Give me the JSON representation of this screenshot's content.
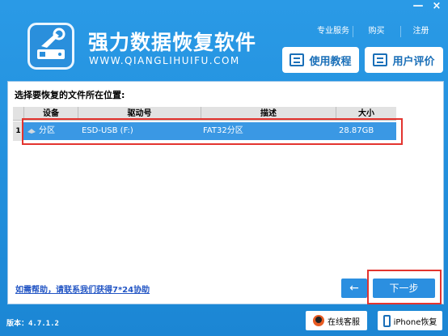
{
  "window": {
    "minimize_label": "—",
    "close_label": "×"
  },
  "header": {
    "title": "强力数据恢复软件",
    "url": "WWW.QIANGLIHUIFU.COM",
    "links": [
      "专业服务",
      "购买",
      "注册"
    ],
    "tutorial_label": "使用教程",
    "review_label": "用户评价"
  },
  "main": {
    "prompt": "选择要恢复的文件所在位置:",
    "columns": [
      "设备",
      "驱动号",
      "描述",
      "大小"
    ],
    "rows": [
      {
        "index": "1",
        "device": "分区",
        "drive": "ESD-USB (F:)",
        "description": "FAT32分区",
        "size": "28.87GB"
      }
    ],
    "help_link": "如需帮助，请联系我们获得7*24协助",
    "back_label": "←",
    "next_label": "下一步"
  },
  "footer": {
    "version": "版本：4.7.1.2",
    "online_service_label": "在线客服",
    "iphone_recovery_label": "iPhone恢复"
  },
  "colors": {
    "background": "#1e88d6",
    "selected_row": "#3a98e4",
    "highlight_border": "#e3342f",
    "button": "#2b8fe0"
  }
}
